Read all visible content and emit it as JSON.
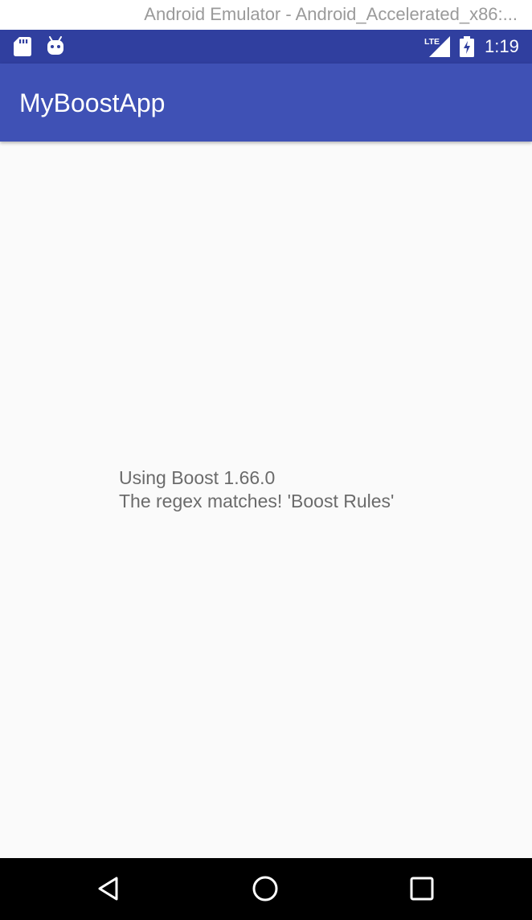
{
  "window": {
    "title": "Android Emulator - Android_Accelerated_x86:..."
  },
  "status_bar": {
    "time": "1:19",
    "network": "LTE",
    "left_icons": [
      "sd-card-icon",
      "android-debug-icon"
    ],
    "right_icons": [
      "lte-signal-icon",
      "battery-charging-icon"
    ]
  },
  "app_bar": {
    "title": "MyBoostApp"
  },
  "content": {
    "lines": [
      "Using Boost 1.66.0",
      "The regex matches! 'Boost Rules'"
    ]
  },
  "nav_bar": {
    "buttons": [
      "back-icon",
      "home-icon",
      "recents-icon"
    ]
  },
  "colors": {
    "status_bar": "#303f9f",
    "app_bar": "#3f51b5",
    "background": "#fafafa",
    "text": "#6b6b6b",
    "nav_bar": "#000000"
  }
}
